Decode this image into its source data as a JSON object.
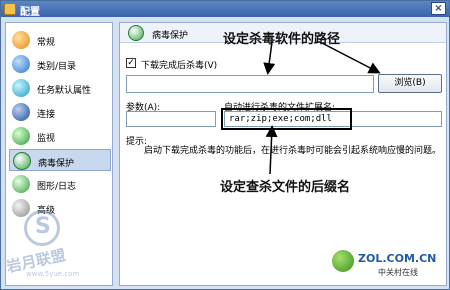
{
  "window": {
    "title": "配置",
    "close_glyph": "×"
  },
  "sidebar": {
    "items": [
      {
        "label": "常规",
        "icon": "general-icon",
        "active": false
      },
      {
        "label": "类别/目录",
        "icon": "category-icon",
        "active": false
      },
      {
        "label": "任务默认属性",
        "icon": "task-defaults-icon",
        "active": false
      },
      {
        "label": "连接",
        "icon": "connection-icon",
        "active": false
      },
      {
        "label": "监视",
        "icon": "monitor-icon",
        "active": false
      },
      {
        "label": "病毒保护",
        "icon": "virus-protection-icon",
        "active": true
      },
      {
        "label": "图形/日志",
        "icon": "graph-log-icon",
        "active": false
      },
      {
        "label": "高级",
        "icon": "advanced-icon",
        "active": false
      }
    ]
  },
  "panel": {
    "title": "病毒保护",
    "scan_after_download_label": "下载完成后杀毒(V)",
    "scan_after_download_checked": true,
    "scanner_path_value": "",
    "browse_label": "浏览(B)",
    "params_label": "参数(A):",
    "params_value": "",
    "extensions_label": "自动进行杀毒的文件扩展名:",
    "extensions_value": "rar;zip;exe;com;dll",
    "tip_label": "提示:",
    "tip_text": "启动下载完成杀毒的功能后，在进行杀毒时可能会引起系统响应慢的问题。"
  },
  "annotations": {
    "path_note": "设定杀毒软件的路径",
    "ext_note": "设定查杀文件的后缀名"
  },
  "watermark": {
    "site": "岩月联盟",
    "url": "www.5yue.com"
  },
  "branding": {
    "name": "ZOL.COM.CN",
    "sub": "中关村在线"
  }
}
